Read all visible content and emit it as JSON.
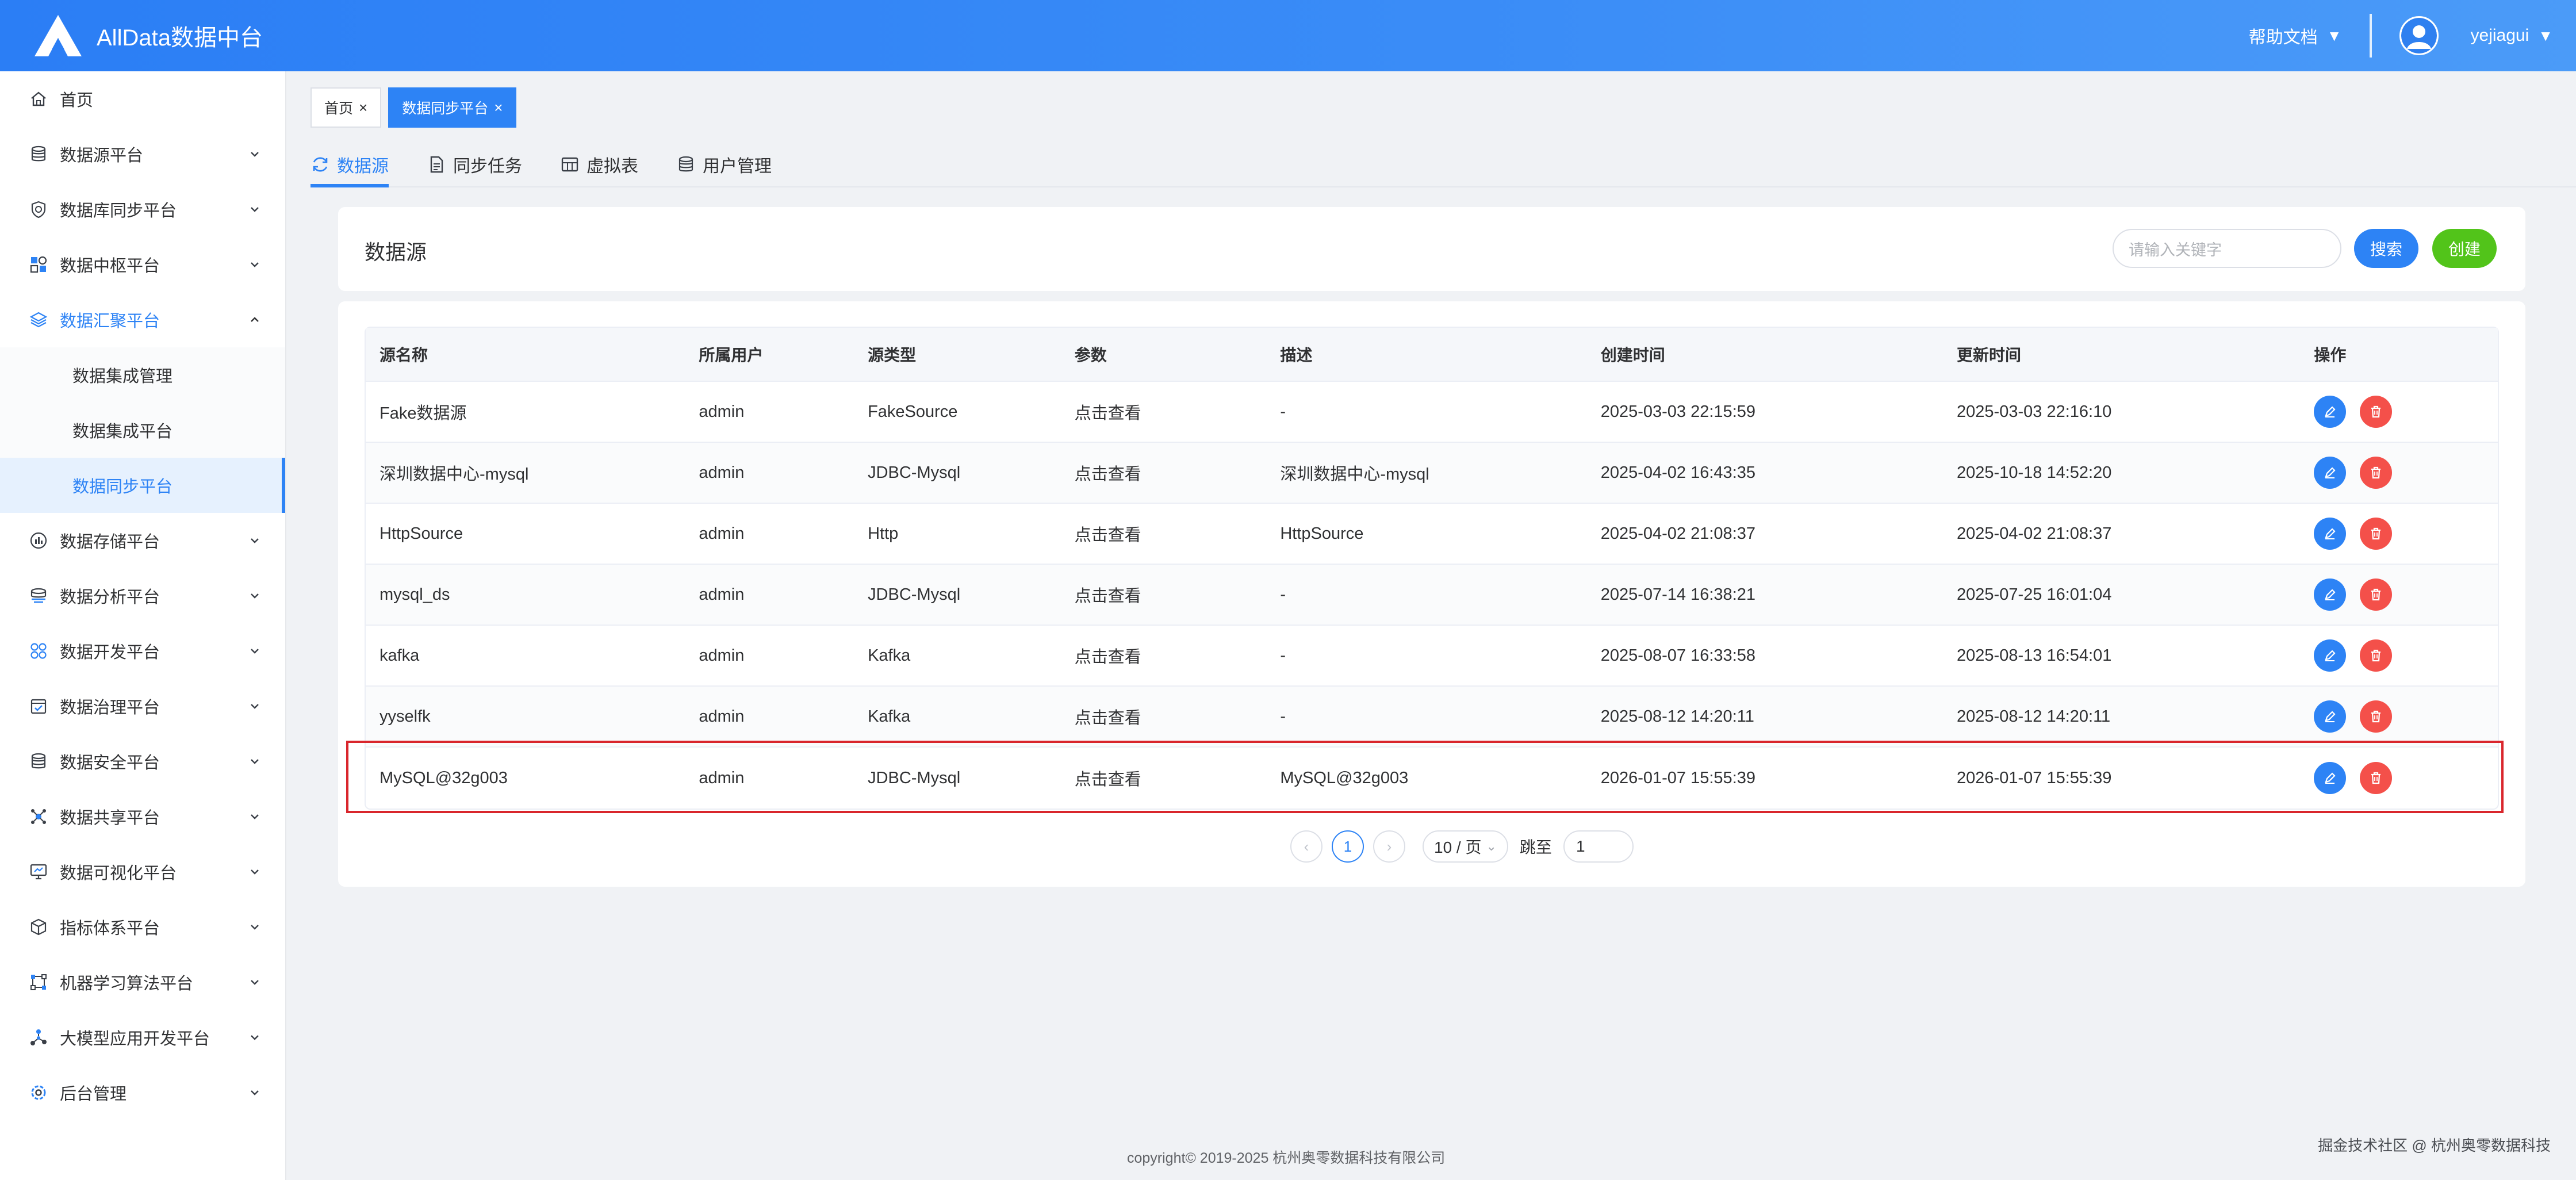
{
  "header": {
    "app_title": "AllData数据中台",
    "help_label": "帮助文档",
    "username": "yejiagui",
    "brand_color": "#2b7ef5"
  },
  "sidebar": {
    "items": [
      {
        "label": "首页",
        "icon": "home-icon"
      },
      {
        "label": "数据源平台",
        "icon": "database-icon"
      },
      {
        "label": "数据库同步平台",
        "icon": "shield-sync-icon"
      },
      {
        "label": "数据中枢平台",
        "icon": "blocks-icon"
      },
      {
        "label": "数据汇聚平台",
        "icon": "layers-icon"
      },
      {
        "label": "数据存储平台",
        "icon": "bar-chart-icon"
      },
      {
        "label": "数据分析平台",
        "icon": "analysis-icon"
      },
      {
        "label": "数据开发平台",
        "icon": "grid-icon"
      },
      {
        "label": "数据治理平台",
        "icon": "checklist-icon"
      },
      {
        "label": "数据安全平台",
        "icon": "database-lock-icon"
      },
      {
        "label": "数据共享平台",
        "icon": "share-hub-icon"
      },
      {
        "label": "数据可视化平台",
        "icon": "monitor-icon"
      },
      {
        "label": "指标体系平台",
        "icon": "cube-icon"
      },
      {
        "label": "机器学习算法平台",
        "icon": "network-icon"
      },
      {
        "label": "大模型应用开发平台",
        "icon": "graph-nodes-icon"
      },
      {
        "label": "后台管理",
        "icon": "settings-icon"
      }
    ],
    "sub_items": [
      "数据集成管理",
      "数据集成平台",
      "数据同步平台"
    ]
  },
  "tags": [
    {
      "label": "首页",
      "close": "×"
    },
    {
      "label": "数据同步平台",
      "close": "×"
    }
  ],
  "subtabs": [
    "数据源",
    "同步任务",
    "虚拟表",
    "用户管理"
  ],
  "title_card": {
    "title": "数据源",
    "search_placeholder": "请输入关键字",
    "search_button": "搜索",
    "create_button": "创建"
  },
  "table": {
    "columns": [
      "源名称",
      "所属用户",
      "源类型",
      "参数",
      "描述",
      "创建时间",
      "更新时间",
      "操作"
    ],
    "rows": [
      [
        "Fake数据源",
        "admin",
        "FakeSource",
        "点击查看",
        "-",
        "2025-03-03 22:15:59",
        "2025-03-03 22:16:10"
      ],
      [
        "深圳数据中心-mysql",
        "admin",
        "JDBC-Mysql",
        "点击查看",
        "深圳数据中心-mysql",
        "2025-04-02 16:43:35",
        "2025-10-18 14:52:20"
      ],
      [
        "HttpSource",
        "admin",
        "Http",
        "点击查看",
        "HttpSource",
        "2025-04-02 21:08:37",
        "2025-04-02 21:08:37"
      ],
      [
        "mysql_ds",
        "admin",
        "JDBC-Mysql",
        "点击查看",
        "-",
        "2025-07-14 16:38:21",
        "2025-07-25 16:01:04"
      ],
      [
        "kafka",
        "admin",
        "Kafka",
        "点击查看",
        "-",
        "2025-08-07 16:33:58",
        "2025-08-13 16:54:01"
      ],
      [
        "yyselfk",
        "admin",
        "Kafka",
        "点击查看",
        "-",
        "2025-08-12 14:20:11",
        "2025-08-12 14:20:11"
      ],
      [
        "MySQL@32g003",
        "admin",
        "JDBC-Mysql",
        "点击查看",
        "MySQL@32g003",
        "2026-01-07 15:55:39",
        "2026-01-07 15:55:39"
      ]
    ]
  },
  "pagination": {
    "prev": "‹",
    "current_page": "1",
    "next": "›",
    "page_size": "10 / 页",
    "jump_label": "跳至",
    "jump_value": "1"
  },
  "footer": {
    "copyright": "copyright© 2019-2025 杭州奥零数据科技有限公司",
    "watermark": "掘金技术社区 @ 杭州奥零数据科技"
  }
}
